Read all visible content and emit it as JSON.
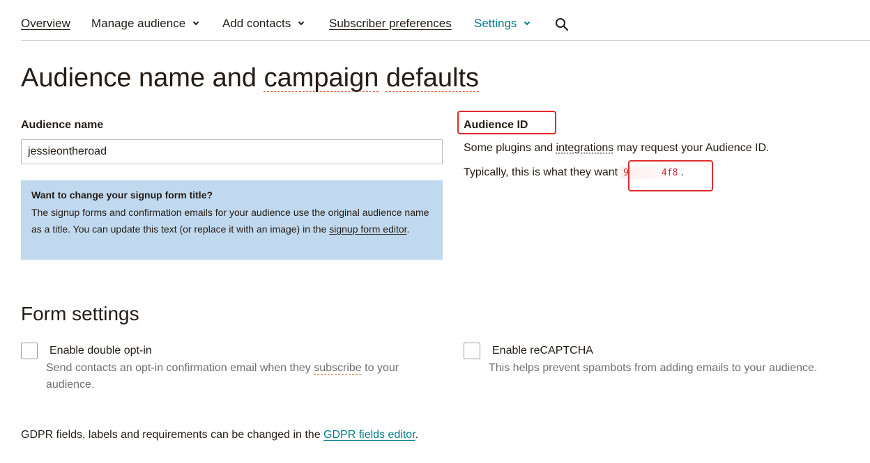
{
  "nav": {
    "items": [
      {
        "label": "Overview",
        "dropdown": false
      },
      {
        "label": "Manage audience",
        "dropdown": true
      },
      {
        "label": "Add contacts",
        "dropdown": true
      },
      {
        "label": "Subscriber preferences",
        "dropdown": false
      },
      {
        "label": "Settings",
        "dropdown": true,
        "active": true
      }
    ],
    "search_icon": "search-icon"
  },
  "page": {
    "title_part1": "Audience name and ",
    "title_word2": "campaign",
    "title_space": " ",
    "title_word3": "defaults"
  },
  "audience_name": {
    "label": "Audience name",
    "value": "jessieontheroad"
  },
  "info_box": {
    "title": "Want to change your signup form title?",
    "body": "The signup forms and confirmation emails for your audience use the original audience name as a title. You can update this text (or replace it with an image) in the ",
    "link": "signup form editor",
    "end": "."
  },
  "audience_id": {
    "label": "Audience ID",
    "line1_a": "Some plugins and ",
    "line1_link": "integrations",
    "line1_b": " may request your Audience ID.",
    "line2": "Typically, this is what they want",
    "code": "9      4f8",
    "end": "."
  },
  "form_settings": {
    "title": "Form settings",
    "double_optin": {
      "label": "Enable double opt-in",
      "help_a": "Send contacts an opt-in confirmation email when they ",
      "help_link": "subscribe",
      "help_b": " to your audience.",
      "checked": false
    },
    "recaptcha": {
      "label": "Enable reCAPTCHA",
      "help": "This helps prevent spambots from adding emails to your audience.",
      "checked": false
    }
  },
  "gdpr": {
    "text": "GDPR fields, labels and requirements can be changed in the ",
    "link": "GDPR fields editor",
    "end": "."
  },
  "colors": {
    "accent": "#007c89",
    "info_box_bg": "#c1d9ee",
    "highlight_border": "#e02b2b",
    "id_text": "#c6262e"
  }
}
